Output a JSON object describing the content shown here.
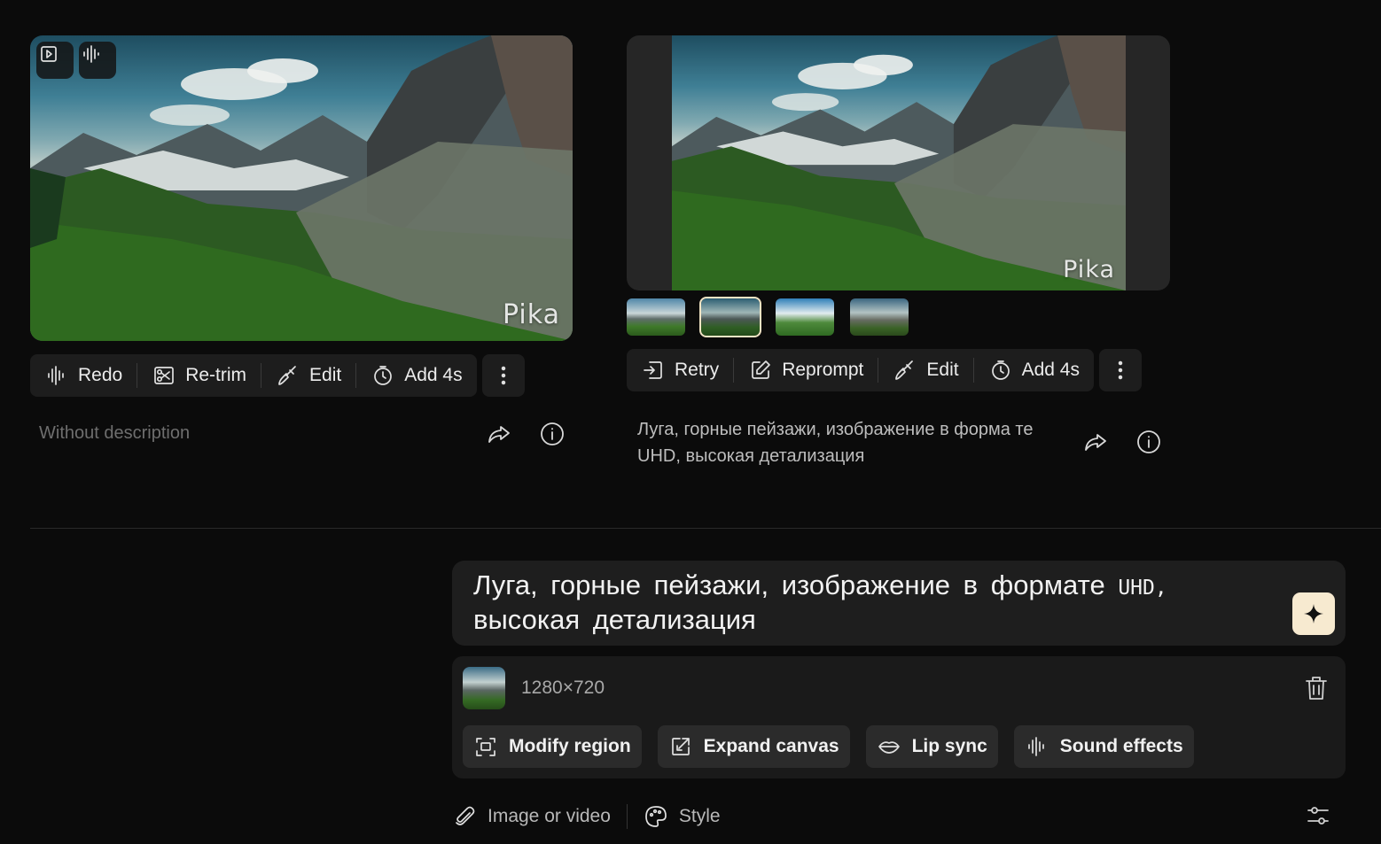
{
  "left_card": {
    "watermark": "Pika",
    "overlay_icons": [
      "video-play-icon",
      "sound-wave-icon"
    ],
    "toolbar": {
      "redo": "Redo",
      "retrim": "Re-trim",
      "edit": "Edit",
      "add": "Add 4s"
    },
    "description": "Without description"
  },
  "right_card": {
    "watermark": "Pika",
    "thumbnail_count": 4,
    "selected_thumbnail": 2,
    "toolbar": {
      "retry": "Retry",
      "reprompt": "Reprompt",
      "edit": "Edit",
      "add": "Add 4s"
    },
    "description": "Луга, горные пейзажи, изображение в форма те UHD, высокая детализация"
  },
  "prompt": {
    "text_before": "Луга, горные пейзажи, изображение в формате",
    "text_mono": "UHD,",
    "text_after": "высокая детализация"
  },
  "media": {
    "resolution": "1280×720",
    "chips": {
      "modify": "Modify region",
      "expand": "Expand canvas",
      "lipsync": "Lip sync",
      "sound": "Sound effects"
    }
  },
  "bottom": {
    "attach": "Image or video",
    "style": "Style"
  },
  "colors": {
    "background": "#0b0b0b",
    "panel": "#1e1e1e",
    "accent_button": "#f7ead0",
    "selected_outline": "#f1e4c4"
  }
}
